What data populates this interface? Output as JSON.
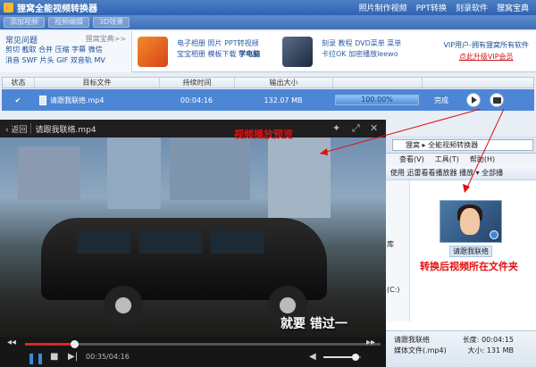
{
  "app": {
    "title": "狸窝全能视频转换器",
    "menu": [
      "照片制作视频",
      "PPT转换",
      "刻录软件",
      "狸窝宝典"
    ]
  },
  "toolbar": {
    "buttons": [
      "添加视频",
      "视频编辑",
      "3D效果"
    ]
  },
  "info": {
    "faq_title": "常见问题",
    "faq_link": "狸窝宝典>>",
    "faq_lines": [
      "剪切 截取 合并 压缩 字幕 微信",
      "消音 SWF 片头 GIF 双音轨 MV"
    ],
    "promo1_lines": [
      "电子相册 照片 PPT转视频",
      "宝宝相册 模板下载"
    ],
    "promo1_bold": "学电脑",
    "promo2_lines": [
      "刻录 教程 DVD菜单 菜单",
      "卡拉OK 加密播放leewo"
    ],
    "vip_line": "VIP用户-拥有狸窝所有软件",
    "vip_link": "点此升级VIP会员"
  },
  "table": {
    "headers": [
      "状态",
      "目标文件",
      "持续时间",
      "输出大小",
      "",
      ""
    ],
    "row": {
      "filename": "请跟我联络.mp4",
      "duration": "00:04:16",
      "size": "132.07 MB",
      "progress_text": "100.00%",
      "progress_value": 1.0,
      "status": "完成"
    }
  },
  "player": {
    "back": "返回",
    "filename": "请跟我联络.mp4",
    "subtitle": "就要 错过一",
    "time": "00:35/04:16",
    "seek_fraction": 0.137,
    "volume_fraction": 0.85
  },
  "folder": {
    "address": "狸窝 ▸ 全能视频转换器",
    "menu": [
      "查看(V)",
      "工具(T)",
      "帮助(H)"
    ],
    "cmd": "使用 迅雷看看播放器 播放 ▾    全部播",
    "nav": [
      "库",
      "(C:)"
    ],
    "file_label": "请跟我联络",
    "status_name": "请跟我联络",
    "status_type": "媒体文件(.mp4)",
    "status_length_label": "长度:",
    "status_length": "00:04:15",
    "status_size_label": "大小:",
    "status_size": "131 MB"
  },
  "annotations": {
    "preview": "视频播放预览",
    "folder": "转换后视频所在文件夹"
  },
  "colors": {
    "accent": "#4e86d6",
    "annotation": "#e01010"
  }
}
